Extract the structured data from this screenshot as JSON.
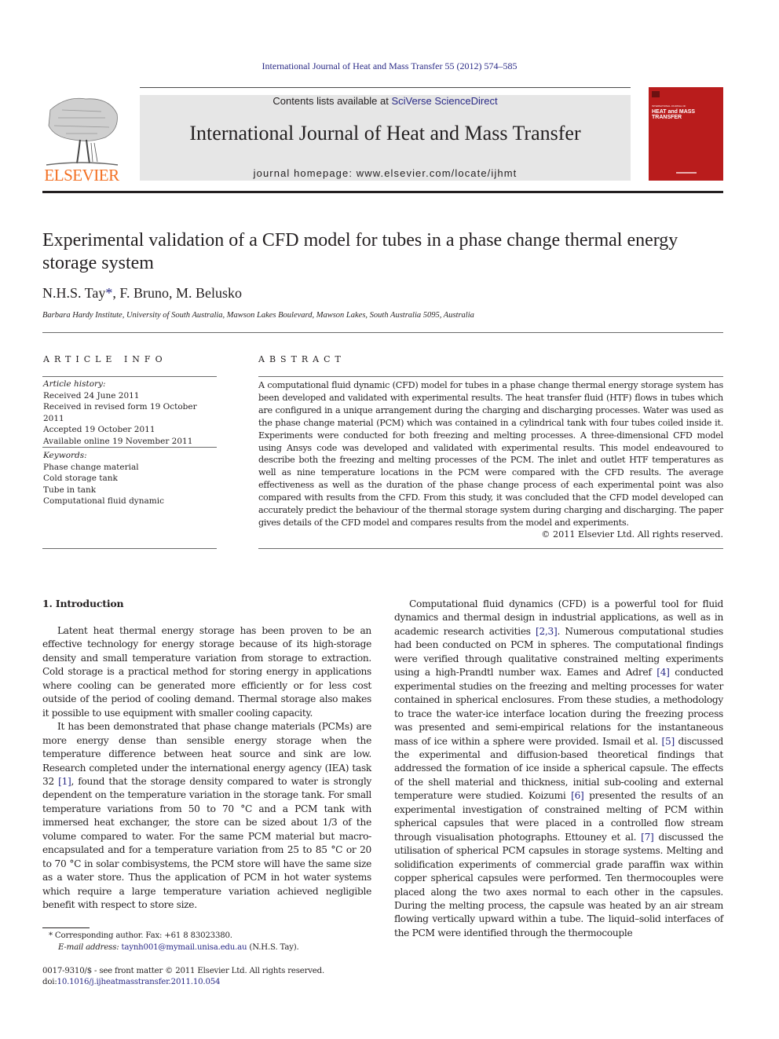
{
  "header": {
    "citation": "International Journal of Heat and Mass Transfer 55 (2012) 574–585",
    "contents_prefix": "Contents lists available at ",
    "contents_link": "SciVerse ScienceDirect",
    "journal_name": "International Journal of Heat and Mass Transfer",
    "homepage_label": "journal homepage: ",
    "homepage_url": "www.elsevier.com/locate/ijhmt",
    "publisher_logo_text": "ELSEVIER",
    "cover": {
      "small_text": "INTERNATIONAL JOURNAL OF",
      "title_line1": "HEAT and MASS",
      "title_line2": "TRANSFER",
      "color": "#b91c1c"
    },
    "publisher_color": "#f36f21",
    "link_color": "#2a2a86"
  },
  "article": {
    "title": "Experimental validation of a CFD model for tubes in a phase change thermal energy storage system",
    "authors": [
      {
        "name": "N.H.S. Tay",
        "mark": "*"
      },
      {
        "name": ", F. Bruno, M. Belusko",
        "mark": ""
      }
    ],
    "affiliation": "Barbara Hardy Institute, University of South Australia, Mawson Lakes Boulevard, Mawson Lakes, South Australia 5095, Australia"
  },
  "article_info": {
    "heading": "ARTICLE INFO",
    "history_label": "Article history:",
    "history": [
      "Received 24 June 2011",
      "Received in revised form 19 October 2011",
      "Accepted 19 October 2011",
      "Available online 19 November 2011"
    ],
    "keywords_label": "Keywords:",
    "keywords": [
      "Phase change material",
      "Cold storage tank",
      "Tube in tank",
      "Computational fluid dynamic"
    ]
  },
  "abstract": {
    "heading": "ABSTRACT",
    "text": "A computational fluid dynamic (CFD) model for tubes in a phase change thermal energy storage system has been developed and validated with experimental results. The heat transfer fluid (HTF) flows in tubes which are configured in a unique arrangement during the charging and discharging processes. Water was used as the phase change material (PCM) which was contained in a cylindrical tank with four tubes coiled inside it. Experiments were conducted for both freezing and melting processes. A three-dimensional CFD model using Ansys code was developed and validated with experimental results. This model endeavoured to describe both the freezing and melting processes of the PCM. The inlet and outlet HTF temperatures as well as nine temperature locations in the PCM were compared with the CFD results. The average effectiveness as well as the duration of the phase change process of each experimental point was also compared with results from the CFD. From this study, it was concluded that the CFD model developed can accurately predict the behaviour of the thermal storage system during charging and discharging. The paper gives details of the CFD model and compares results from the model and experiments.",
    "copyright": "© 2011 Elsevier Ltd. All rights reserved."
  },
  "body": {
    "section_heading": "1. Introduction",
    "left_paragraphs": [
      [
        {
          "t": "Latent heat thermal energy storage has been proven to be an effective technology for energy storage because of its high-storage density and small temperature variation from storage to extraction. Cold storage is a practical method for storing energy in applications where cooling can be generated more efficiently or for less cost outside of the period of cooling demand. Thermal storage also makes it possible to use equipment with smaller cooling capacity."
        }
      ],
      [
        {
          "t": "It has been demonstrated that phase change materials (PCMs) are more energy dense than sensible energy storage when the temperature difference between heat source and sink are low. Research completed under the international energy agency (IEA) task 32 "
        },
        {
          "ref": "[1]"
        },
        {
          "t": ", found that the storage density compared to water is strongly dependent on the temperature variation in the storage tank. For small temperature variations from 50 to 70 °C and a PCM tank with immersed heat exchanger, the store can be sized about 1/3 of the volume compared to water. For the same PCM material but macro-encapsulated and for a temperature variation from 25 to 85 °C or 20 to 70 °C in solar combisystems, the PCM store will have the same size as a water store. Thus the application of PCM in hot water systems which require a large temperature variation achieved negligible benefit with respect to store size."
        }
      ]
    ],
    "right_paragraphs": [
      [
        {
          "t": "Computational fluid dynamics (CFD) is a powerful tool for fluid dynamics and thermal design in industrial applications, as well as in academic research activities "
        },
        {
          "ref": "[2,3]"
        },
        {
          "t": ". Numerous computational studies had been conducted on PCM in spheres. The computational findings were verified through qualitative constrained melting experiments using a high-Prandtl number wax. Eames and Adref "
        },
        {
          "ref": "[4]"
        },
        {
          "t": " conducted experimental studies on the freezing and melting processes for water contained in spherical enclosures. From these studies, a methodology to trace the water-ice interface location during the freezing process was presented and semi-empirical relations for the instantaneous mass of ice within a sphere were provided. Ismail et al. "
        },
        {
          "ref": "[5]"
        },
        {
          "t": " discussed the experimental and diffusion-based theoretical findings that addressed the formation of ice inside a spherical capsule. The effects of the shell material and thickness, initial sub-cooling and external temperature were studied. Koizumi "
        },
        {
          "ref": "[6]"
        },
        {
          "t": " presented the results of an experimental investigation of constrained melting of PCM within spherical capsules that were placed in a controlled flow stream through visualisation photographs. Ettouney et al. "
        },
        {
          "ref": "[7]"
        },
        {
          "t": " discussed the utilisation of spherical PCM capsules in storage systems. Melting and solidification experiments of commercial grade paraffin wax within copper spherical capsules were performed. Ten thermocouples were placed along the two axes normal to each other in the capsules. During the melting process, the capsule was heated by an air stream flowing vertically upward within a tube. The liquid–solid interfaces of the PCM were identified through the thermocouple"
        }
      ]
    ]
  },
  "footnotes": {
    "corresponding": "* Corresponding author. Fax: +61 8 83023380.",
    "email_label": "E-mail address: ",
    "email": "taynh001@mymail.unisa.edu.au",
    "email_suffix": " (N.H.S. Tay).",
    "issn_line": "0017-9310/$ - see front matter © 2011 Elsevier Ltd. All rights reserved.",
    "doi_label": "doi:",
    "doi": "10.1016/j.ijheatmasstransfer.2011.10.054"
  }
}
